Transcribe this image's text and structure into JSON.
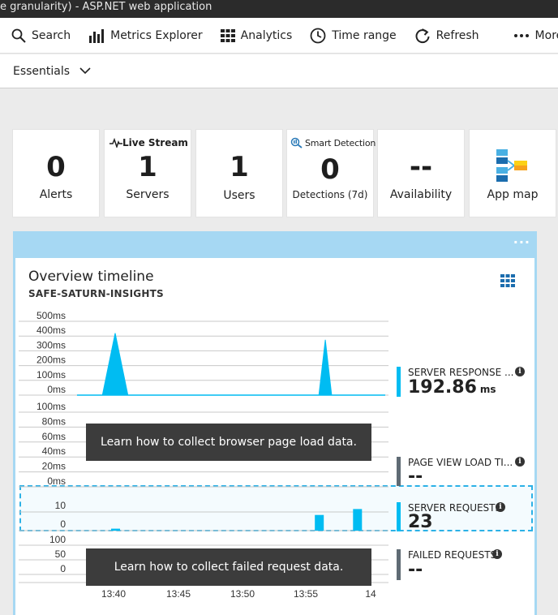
{
  "title_bar": {
    "text": "e granularity) - ASP.NET web application"
  },
  "toolbar": {
    "items": [
      {
        "label": "Search",
        "icon": "search-icon"
      },
      {
        "label": "Metrics Explorer",
        "icon": "bar-chart-icon"
      },
      {
        "label": "Analytics",
        "icon": "grid-table-icon"
      },
      {
        "label": "Time range",
        "icon": "clock-icon"
      },
      {
        "label": "Refresh",
        "icon": "refresh-icon"
      },
      {
        "label": "More",
        "icon": "ellipsis-icon"
      }
    ]
  },
  "essentials": {
    "label": "Essentials"
  },
  "tiles": [
    {
      "value": "0",
      "label": "Alerts"
    },
    {
      "header": "Live Stream",
      "value": "1",
      "label": "Servers"
    },
    {
      "value": "1",
      "label": "Users"
    },
    {
      "header": "Smart Detection",
      "value": "0",
      "label": "Detections (7d)"
    },
    {
      "value": "--",
      "label": "Availability"
    },
    {
      "value": "",
      "label": "App map"
    }
  ],
  "panel": {
    "title": "Overview timeline",
    "subtitle": "SAFE-SATURN-INSIGHTS",
    "more": "···"
  },
  "tips": {
    "browser": "Learn how to collect browser page load data.",
    "failed": "Learn how to collect failed request data."
  },
  "metrics": [
    {
      "name": "SERVER RESPONSE ...",
      "value": "192.86",
      "unit": "ms",
      "color": "#00bcf2"
    },
    {
      "name": "PAGE VIEW LOAD TI...",
      "value": "--",
      "unit": "",
      "color": "#5f6b74"
    },
    {
      "name": "SERVER REQUESTS",
      "value": "23",
      "unit": "",
      "color": "#00bcf2"
    },
    {
      "name": "FAILED REQUESTS",
      "value": "--",
      "unit": "",
      "color": "#5f6b74"
    }
  ],
  "chart_data": [
    {
      "type": "area",
      "name": "server-response-time",
      "ytick_labels": [
        "500ms",
        "400ms",
        "300ms",
        "200ms",
        "100ms",
        "0ms"
      ],
      "ylim": [
        0,
        500
      ],
      "x": [
        "13:37",
        "13:39",
        "13:40",
        "13:41",
        "13:42",
        "13:56",
        "13:56.5",
        "13:57",
        "13:57.5",
        "14:00"
      ],
      "values": [
        0,
        0,
        420,
        0,
        0,
        0,
        375,
        0,
        0,
        0
      ],
      "color": "#00bcf2"
    },
    {
      "type": "line",
      "name": "page-view-load-time",
      "ytick_labels": [
        "100ms",
        "80ms",
        "60ms",
        "40ms",
        "20ms",
        "0ms"
      ],
      "ylim": [
        0,
        100
      ],
      "values": []
    },
    {
      "type": "bar",
      "name": "server-requests",
      "ytick_labels": [
        "10",
        "0"
      ],
      "categories": [
        "13:40",
        "13:56",
        "13:59"
      ],
      "values": [
        1,
        8,
        11
      ],
      "color": "#00bcf2"
    },
    {
      "type": "bar",
      "name": "failed-requests",
      "ytick_labels": [
        "100",
        "50",
        "0"
      ],
      "ylim": [
        0,
        100
      ],
      "values": []
    }
  ],
  "x_axis": {
    "tick_labels": [
      "13:40",
      "13:45",
      "13:50",
      "13:55",
      "14"
    ]
  }
}
